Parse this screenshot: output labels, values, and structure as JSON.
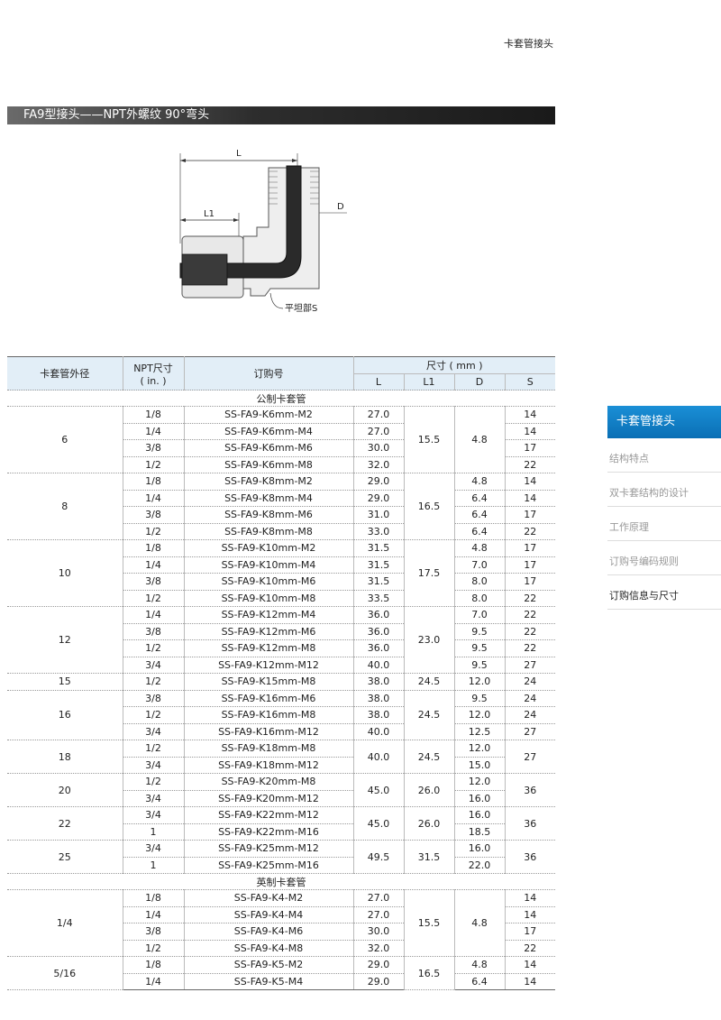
{
  "header": {
    "category": "卡套管接头"
  },
  "title": "FA9型接头——NPT外螺纹 90°弯头",
  "diagram": {
    "label_L": "L",
    "label_L1": "L1",
    "label_D": "D",
    "label_S": "平坦部S"
  },
  "table": {
    "headers": {
      "tube_od": "卡套管外径",
      "npt_size": "NPT尺寸",
      "npt_unit": "( in. )",
      "order_no": "订购号",
      "dims": "尺寸 ( mm )",
      "L": "L",
      "L1": "L1",
      "D": "D",
      "S": "S"
    },
    "metric_label": "公制卡套管",
    "imperial_label": "英制卡套管",
    "rows": [
      [
        "6",
        "1/8",
        "SS-FA9-K6mm-M2",
        "27.0",
        "15.5",
        "4.8",
        "14"
      ],
      [
        "",
        "1/4",
        "SS-FA9-K6mm-M4",
        "27.0",
        "",
        "",
        "14"
      ],
      [
        "",
        "3/8",
        "SS-FA9-K6mm-M6",
        "30.0",
        "",
        "",
        "17"
      ],
      [
        "",
        "1/2",
        "SS-FA9-K6mm-M8",
        "32.0",
        "",
        "",
        "22"
      ],
      [
        "8",
        "1/8",
        "SS-FA9-K8mm-M2",
        "29.0",
        "16.5",
        "4.8",
        "14"
      ],
      [
        "",
        "1/4",
        "SS-FA9-K8mm-M4",
        "29.0",
        "",
        "6.4",
        "14"
      ],
      [
        "",
        "3/8",
        "SS-FA9-K8mm-M6",
        "31.0",
        "",
        "6.4",
        "17"
      ],
      [
        "",
        "1/2",
        "SS-FA9-K8mm-M8",
        "33.0",
        "",
        "6.4",
        "22"
      ],
      [
        "10",
        "1/8",
        "SS-FA9-K10mm-M2",
        "31.5",
        "17.5",
        "4.8",
        "17"
      ],
      [
        "",
        "1/4",
        "SS-FA9-K10mm-M4",
        "31.5",
        "",
        "7.0",
        "17"
      ],
      [
        "",
        "3/8",
        "SS-FA9-K10mm-M6",
        "31.5",
        "",
        "8.0",
        "17"
      ],
      [
        "",
        "1/2",
        "SS-FA9-K10mm-M8",
        "33.5",
        "",
        "8.0",
        "22"
      ],
      [
        "12",
        "1/4",
        "SS-FA9-K12mm-M4",
        "36.0",
        "23.0",
        "7.0",
        "22"
      ],
      [
        "",
        "3/8",
        "SS-FA9-K12mm-M6",
        "36.0",
        "",
        "9.5",
        "22"
      ],
      [
        "",
        "1/2",
        "SS-FA9-K12mm-M8",
        "36.0",
        "",
        "9.5",
        "22"
      ],
      [
        "",
        "3/4",
        "SS-FA9-K12mm-M12",
        "40.0",
        "",
        "9.5",
        "27"
      ],
      [
        "15",
        "1/2",
        "SS-FA9-K15mm-M8",
        "38.0",
        "24.5",
        "12.0",
        "24"
      ],
      [
        "16",
        "3/8",
        "SS-FA9-K16mm-M6",
        "38.0",
        "24.5",
        "9.5",
        "24"
      ],
      [
        "",
        "1/2",
        "SS-FA9-K16mm-M8",
        "38.0",
        "",
        "12.0",
        "24"
      ],
      [
        "",
        "3/4",
        "SS-FA9-K16mm-M12",
        "40.0",
        "",
        "12.5",
        "27"
      ],
      [
        "18",
        "1/2",
        "SS-FA9-K18mm-M8",
        "40.0",
        "24.5",
        "12.0",
        "27"
      ],
      [
        "",
        "3/4",
        "SS-FA9-K18mm-M12",
        "",
        "",
        "15.0",
        ""
      ],
      [
        "20",
        "1/2",
        "SS-FA9-K20mm-M8",
        "45.0",
        "26.0",
        "12.0",
        "36"
      ],
      [
        "",
        "3/4",
        "SS-FA9-K20mm-M12",
        "",
        "",
        "16.0",
        ""
      ],
      [
        "22",
        "3/4",
        "SS-FA9-K22mm-M12",
        "45.0",
        "26.0",
        "16.0",
        "36"
      ],
      [
        "",
        "1",
        "SS-FA9-K22mm-M16",
        "",
        "",
        "18.5",
        ""
      ],
      [
        "25",
        "3/4",
        "SS-FA9-K25mm-M12",
        "49.5",
        "31.5",
        "16.0",
        "36"
      ],
      [
        "",
        "1",
        "SS-FA9-K25mm-M16",
        "",
        "",
        "22.0",
        ""
      ],
      [
        "1/4",
        "1/8",
        "SS-FA9-K4-M2",
        "27.0",
        "15.5",
        "4.8",
        "14"
      ],
      [
        "",
        "1/4",
        "SS-FA9-K4-M4",
        "27.0",
        "",
        "",
        "14"
      ],
      [
        "",
        "3/8",
        "SS-FA9-K4-M6",
        "30.0",
        "",
        "",
        "17"
      ],
      [
        "",
        "1/2",
        "SS-FA9-K4-M8",
        "32.0",
        "",
        "",
        "22"
      ],
      [
        "5/16",
        "1/8",
        "SS-FA9-K5-M2",
        "29.0",
        "16.5",
        "4.8",
        "14"
      ],
      [
        "",
        "1/4",
        "SS-FA9-K5-M4",
        "29.0",
        "",
        "6.4",
        "14"
      ]
    ]
  },
  "sidebar": {
    "active": "卡套管接头",
    "items": [
      "结构特点",
      "双卡套结构的设计",
      "工作原理",
      "订购号编码规则",
      "订购信息与尺寸"
    ]
  }
}
